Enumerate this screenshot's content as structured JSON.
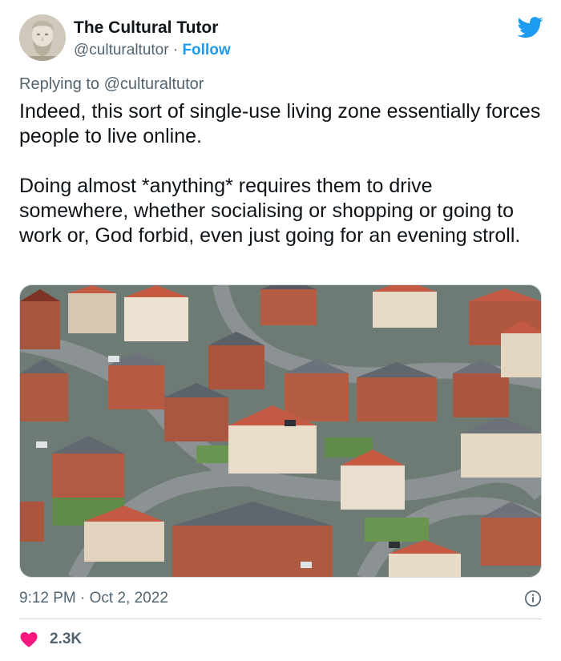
{
  "author": {
    "name": "The Cultural Tutor",
    "handle": "@culturaltutor",
    "separator": "·",
    "follow_label": "Follow",
    "avatar_icon": "bust-statue-avatar"
  },
  "reply": {
    "prefix": "Replying to",
    "handle": "@culturaltutor"
  },
  "tweet": {
    "paragraphs": [
      "Indeed, this sort of single-use living zone essentially forces people to live online.",
      "Doing almost *anything* requires them to drive somewhere, whether socialising or shopping or going to work or, God forbid, even just going for an evening stroll."
    ]
  },
  "media": {
    "icon": "aerial-housing-estate-photo"
  },
  "meta": {
    "time": "9:12 PM",
    "separator": "·",
    "date": "Oct 2, 2022"
  },
  "engagement": {
    "likes": "2.3K"
  },
  "colors": {
    "accent": "#1d9bf0",
    "like": "#f91880",
    "muted": "#536471",
    "text": "#0f1419"
  },
  "icons": {
    "brand": "twitter-bird-icon",
    "info": "info-icon",
    "like": "heart-icon"
  }
}
